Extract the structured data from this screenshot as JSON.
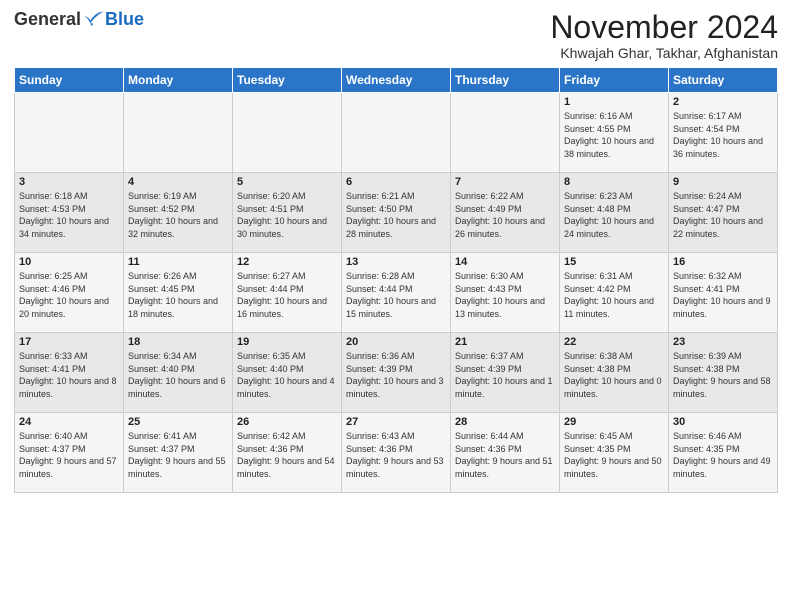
{
  "logo": {
    "general": "General",
    "blue": "Blue"
  },
  "title": "November 2024",
  "location": "Khwajah Ghar, Takhar, Afghanistan",
  "weekdays": [
    "Sunday",
    "Monday",
    "Tuesday",
    "Wednesday",
    "Thursday",
    "Friday",
    "Saturday"
  ],
  "weeks": [
    [
      {
        "day": "",
        "info": ""
      },
      {
        "day": "",
        "info": ""
      },
      {
        "day": "",
        "info": ""
      },
      {
        "day": "",
        "info": ""
      },
      {
        "day": "",
        "info": ""
      },
      {
        "day": "1",
        "info": "Sunrise: 6:16 AM\nSunset: 4:55 PM\nDaylight: 10 hours and 38 minutes."
      },
      {
        "day": "2",
        "info": "Sunrise: 6:17 AM\nSunset: 4:54 PM\nDaylight: 10 hours and 36 minutes."
      }
    ],
    [
      {
        "day": "3",
        "info": "Sunrise: 6:18 AM\nSunset: 4:53 PM\nDaylight: 10 hours and 34 minutes."
      },
      {
        "day": "4",
        "info": "Sunrise: 6:19 AM\nSunset: 4:52 PM\nDaylight: 10 hours and 32 minutes."
      },
      {
        "day": "5",
        "info": "Sunrise: 6:20 AM\nSunset: 4:51 PM\nDaylight: 10 hours and 30 minutes."
      },
      {
        "day": "6",
        "info": "Sunrise: 6:21 AM\nSunset: 4:50 PM\nDaylight: 10 hours and 28 minutes."
      },
      {
        "day": "7",
        "info": "Sunrise: 6:22 AM\nSunset: 4:49 PM\nDaylight: 10 hours and 26 minutes."
      },
      {
        "day": "8",
        "info": "Sunrise: 6:23 AM\nSunset: 4:48 PM\nDaylight: 10 hours and 24 minutes."
      },
      {
        "day": "9",
        "info": "Sunrise: 6:24 AM\nSunset: 4:47 PM\nDaylight: 10 hours and 22 minutes."
      }
    ],
    [
      {
        "day": "10",
        "info": "Sunrise: 6:25 AM\nSunset: 4:46 PM\nDaylight: 10 hours and 20 minutes."
      },
      {
        "day": "11",
        "info": "Sunrise: 6:26 AM\nSunset: 4:45 PM\nDaylight: 10 hours and 18 minutes."
      },
      {
        "day": "12",
        "info": "Sunrise: 6:27 AM\nSunset: 4:44 PM\nDaylight: 10 hours and 16 minutes."
      },
      {
        "day": "13",
        "info": "Sunrise: 6:28 AM\nSunset: 4:44 PM\nDaylight: 10 hours and 15 minutes."
      },
      {
        "day": "14",
        "info": "Sunrise: 6:30 AM\nSunset: 4:43 PM\nDaylight: 10 hours and 13 minutes."
      },
      {
        "day": "15",
        "info": "Sunrise: 6:31 AM\nSunset: 4:42 PM\nDaylight: 10 hours and 11 minutes."
      },
      {
        "day": "16",
        "info": "Sunrise: 6:32 AM\nSunset: 4:41 PM\nDaylight: 10 hours and 9 minutes."
      }
    ],
    [
      {
        "day": "17",
        "info": "Sunrise: 6:33 AM\nSunset: 4:41 PM\nDaylight: 10 hours and 8 minutes."
      },
      {
        "day": "18",
        "info": "Sunrise: 6:34 AM\nSunset: 4:40 PM\nDaylight: 10 hours and 6 minutes."
      },
      {
        "day": "19",
        "info": "Sunrise: 6:35 AM\nSunset: 4:40 PM\nDaylight: 10 hours and 4 minutes."
      },
      {
        "day": "20",
        "info": "Sunrise: 6:36 AM\nSunset: 4:39 PM\nDaylight: 10 hours and 3 minutes."
      },
      {
        "day": "21",
        "info": "Sunrise: 6:37 AM\nSunset: 4:39 PM\nDaylight: 10 hours and 1 minute."
      },
      {
        "day": "22",
        "info": "Sunrise: 6:38 AM\nSunset: 4:38 PM\nDaylight: 10 hours and 0 minutes."
      },
      {
        "day": "23",
        "info": "Sunrise: 6:39 AM\nSunset: 4:38 PM\nDaylight: 9 hours and 58 minutes."
      }
    ],
    [
      {
        "day": "24",
        "info": "Sunrise: 6:40 AM\nSunset: 4:37 PM\nDaylight: 9 hours and 57 minutes."
      },
      {
        "day": "25",
        "info": "Sunrise: 6:41 AM\nSunset: 4:37 PM\nDaylight: 9 hours and 55 minutes."
      },
      {
        "day": "26",
        "info": "Sunrise: 6:42 AM\nSunset: 4:36 PM\nDaylight: 9 hours and 54 minutes."
      },
      {
        "day": "27",
        "info": "Sunrise: 6:43 AM\nSunset: 4:36 PM\nDaylight: 9 hours and 53 minutes."
      },
      {
        "day": "28",
        "info": "Sunrise: 6:44 AM\nSunset: 4:36 PM\nDaylight: 9 hours and 51 minutes."
      },
      {
        "day": "29",
        "info": "Sunrise: 6:45 AM\nSunset: 4:35 PM\nDaylight: 9 hours and 50 minutes."
      },
      {
        "day": "30",
        "info": "Sunrise: 6:46 AM\nSunset: 4:35 PM\nDaylight: 9 hours and 49 minutes."
      }
    ]
  ]
}
